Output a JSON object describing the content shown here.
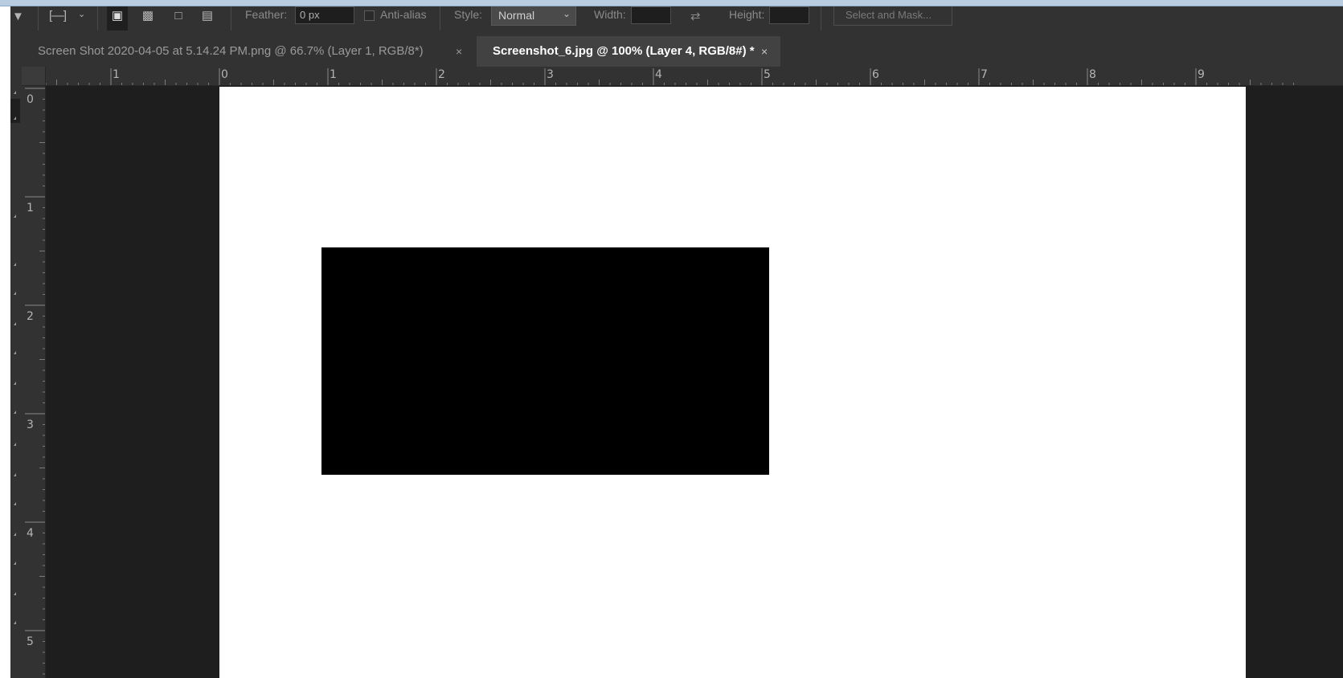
{
  "app": {
    "name": "Adobe Photoshop",
    "accent_color": "#323232",
    "canvas_background": "#1e1e1e",
    "document_color": "#ffffff",
    "shape_color": "#000000"
  },
  "options_bar": {
    "tool_icon": "move-tool-icon",
    "marquee_preset_icon": "rectangular-marquee-icon",
    "selection_modes": [
      {
        "name": "new-selection",
        "active": true
      },
      {
        "name": "add-to-selection",
        "active": false
      },
      {
        "name": "subtract-from-selection",
        "active": false
      },
      {
        "name": "intersect-with-selection",
        "active": false
      }
    ],
    "feather_label": "Feather:",
    "feather_value": "0 px",
    "anti_alias_label": "Anti-alias",
    "style_label": "Style:",
    "style_value": "Normal",
    "width_label": "Width:",
    "width_value": "",
    "height_label": "Height:",
    "height_value": "",
    "select_and_mask_label": "Select and Mask..."
  },
  "tabs": [
    {
      "label": "Screen Shot 2020-04-05 at 5.14.24 PM.png @ 66.7% (Layer 1, RGB/8*)",
      "close": "×",
      "active": false
    },
    {
      "label": "Screenshot_6.jpg @ 100% (Layer 4, RGB/8#) *",
      "close": "×",
      "active": true
    }
  ],
  "ruler_horizontal": {
    "labels": [
      "1",
      "0",
      "1",
      "2",
      "3",
      "4",
      "5",
      "6",
      "7",
      "8",
      "9"
    ]
  },
  "ruler_vertical": {
    "labels": [
      "0",
      "1",
      "2",
      "3",
      "4",
      "5"
    ]
  }
}
